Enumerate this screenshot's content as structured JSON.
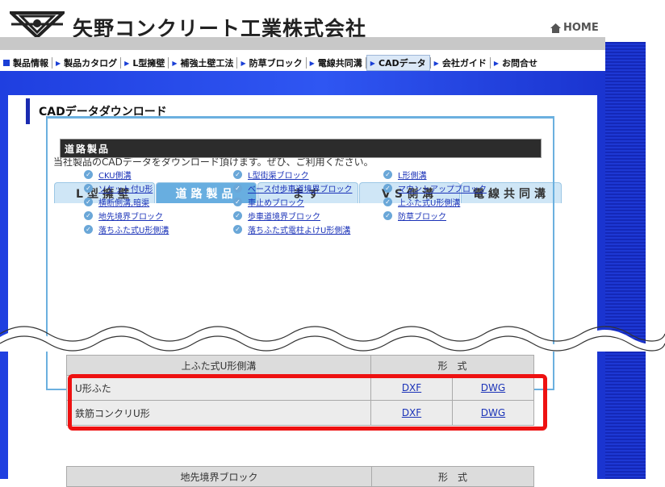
{
  "company_name": "矢野コンクリート工業株式会社",
  "home_label": "HOME",
  "nav": [
    {
      "label": "製品情報",
      "marker": "square"
    },
    {
      "label": "製品カタログ",
      "marker": "triangle"
    },
    {
      "label": "L型擁壁",
      "marker": "triangle"
    },
    {
      "label": "補強土壁工法",
      "marker": "triangle"
    },
    {
      "label": "防草ブロック",
      "marker": "triangle"
    },
    {
      "label": "電線共同溝",
      "marker": "triangle"
    },
    {
      "label": "CADデータ",
      "marker": "triangle",
      "active": true
    },
    {
      "label": "会社ガイド",
      "marker": "triangle"
    },
    {
      "label": "お問合せ",
      "marker": "triangle"
    }
  ],
  "page_title": "CADデータダウンロード",
  "intro": "当社製品のCADデータをダウンロード頂けます。ぜひ、ご利用ください。",
  "tabs": [
    {
      "label": "L型擁壁",
      "active": false
    },
    {
      "label": "道路製品",
      "active": true
    },
    {
      "label": "ます",
      "active": false
    },
    {
      "label": "VS側溝",
      "active": false
    },
    {
      "label": "電線共同溝",
      "active": false
    }
  ],
  "section_title": "道路製品",
  "product_links": [
    [
      "CKU側溝",
      "ソケット付U形",
      "横断側溝,暗渠",
      "地先境界ブロック",
      "落ちふた式U形側溝"
    ],
    [
      "L型街渠ブロック",
      "ベース付歩車道境界ブロック",
      "車止めブロック",
      "歩車道境界ブロック",
      "落ちふた式電柱よけU形側溝"
    ],
    [
      "L形側溝",
      "マウントアップブロック",
      "上ふた式U形側溝",
      "防草ブロック"
    ]
  ],
  "table": {
    "header_name": "上ふた式U形側溝",
    "header_format": "形　式",
    "rows": [
      {
        "name": "U形ふた",
        "dxf": "DXF",
        "dwg": "DWG"
      },
      {
        "name": "鉄筋コンクリU形",
        "dxf": "DXF",
        "dwg": "DWG"
      }
    ]
  },
  "table2": {
    "header_name": "地先境界ブロック",
    "header_format": "形　式"
  },
  "colors": {
    "nav_blue": "#1a3fd6",
    "tab_active": "#68aee0",
    "tab_inactive": "#cfe6f6",
    "highlight": "#e11111"
  }
}
